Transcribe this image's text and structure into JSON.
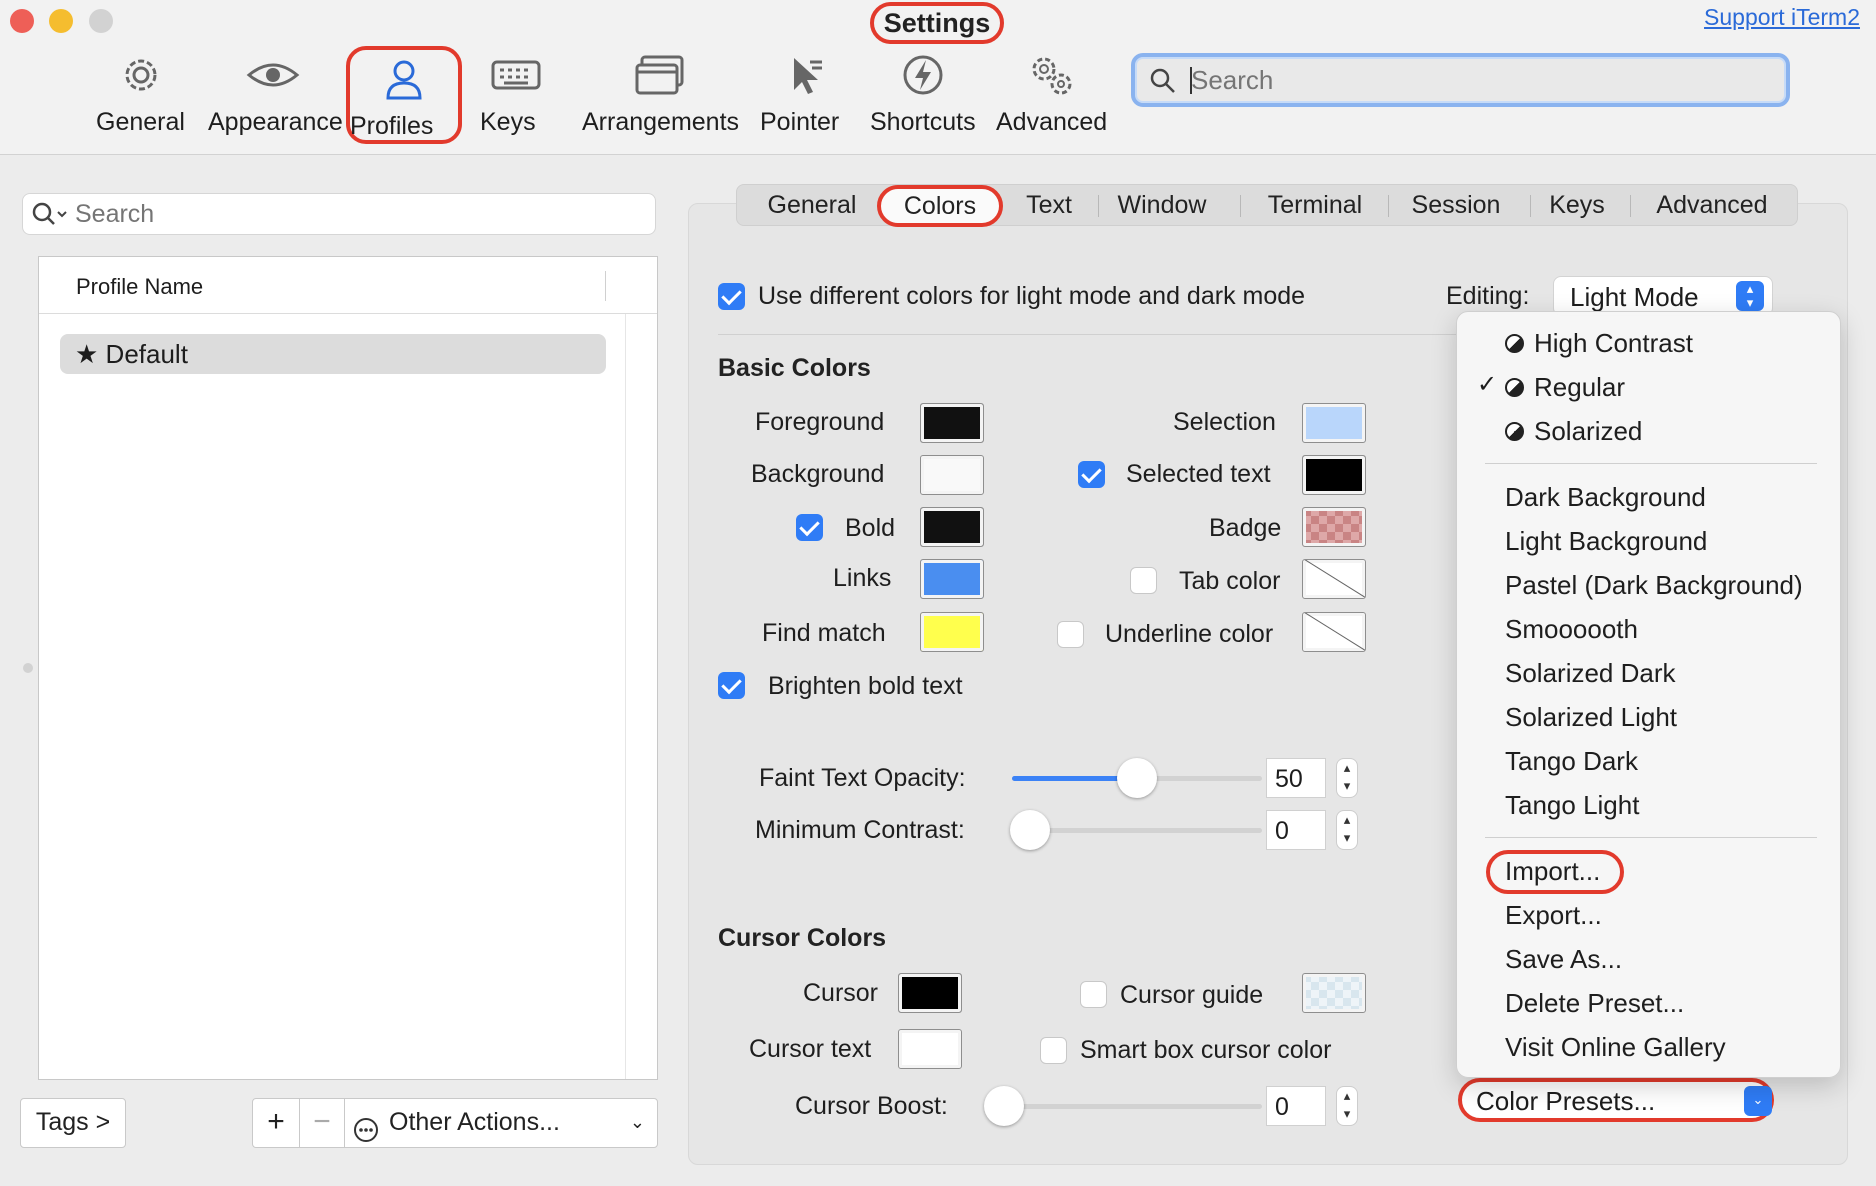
{
  "window": {
    "title": "Settings",
    "support_link": "Support iTerm2"
  },
  "toolbar": {
    "items": [
      {
        "label": "General",
        "icon": "gear-icon"
      },
      {
        "label": "Appearance",
        "icon": "eye-icon"
      },
      {
        "label": "Profiles",
        "icon": "person-icon",
        "selected": true
      },
      {
        "label": "Keys",
        "icon": "keyboard-icon"
      },
      {
        "label": "Arrangements",
        "icon": "windows-icon"
      },
      {
        "label": "Pointer",
        "icon": "pointer-icon"
      },
      {
        "label": "Shortcuts",
        "icon": "bolt-icon"
      },
      {
        "label": "Advanced",
        "icon": "gears-icon"
      }
    ],
    "search_placeholder": "Search"
  },
  "profiles": {
    "search_placeholder": "Search",
    "column_header": "Profile Name",
    "rows": [
      {
        "name": "Default",
        "default": true
      }
    ],
    "tags_button": "Tags >",
    "add_button": "+",
    "remove_button": "−",
    "other_actions": "Other Actions..."
  },
  "tabs": [
    "General",
    "Colors",
    "Text",
    "Window",
    "Terminal",
    "Session",
    "Keys",
    "Advanced"
  ],
  "colors": {
    "light_dark_label": "Use different colors for light mode and dark mode",
    "light_dark_checked": true,
    "editing_label": "Editing:",
    "editing_value": "Light Mode",
    "basic_colors_title": "Basic Colors",
    "foreground_label": "Foreground",
    "background_label": "Background",
    "bold_label": "Bold",
    "links_label": "Links",
    "find_match_label": "Find match",
    "brighten_bold_label": "Brighten bold text",
    "selection_label": "Selection",
    "selected_text_label": "Selected text",
    "badge_label": "Badge",
    "tab_color_label": "Tab color",
    "underline_color_label": "Underline color",
    "swatches": {
      "foreground": "#111111",
      "background": "#f9f9f9",
      "bold": "#111111",
      "links": "#4a8ef0",
      "find_match": "#ffff4d",
      "selection": "#b9d6fb",
      "selected_text": "#000000",
      "cursor": "#000000",
      "cursor_text": "#ffffff"
    },
    "faint_opacity_label": "Faint Text Opacity:",
    "faint_opacity_value": "50",
    "min_contrast_label": "Minimum Contrast:",
    "min_contrast_value": "0",
    "cursor_colors_title": "Cursor Colors",
    "cursor_label": "Cursor",
    "cursor_text_label": "Cursor text",
    "cursor_guide_label": "Cursor guide",
    "smart_box_label": "Smart box cursor color",
    "cursor_boost_label": "Cursor Boost:",
    "cursor_boost_value": "0",
    "color_presets_label": "Color Presets..."
  },
  "presets_menu": {
    "builtin": [
      "High Contrast",
      "Regular",
      "Solarized"
    ],
    "checked_item": "Regular",
    "presets": [
      "Dark Background",
      "Light Background",
      "Pastel (Dark Background)",
      "Smoooooth",
      "Solarized Dark",
      "Solarized Light",
      "Tango Dark",
      "Tango Light"
    ],
    "actions": [
      "Import...",
      "Export...",
      "Save As...",
      "Delete Preset...",
      "Visit Online Gallery"
    ]
  },
  "accent_color": "#2f7cf6",
  "highlight_color": "#e23a2c"
}
